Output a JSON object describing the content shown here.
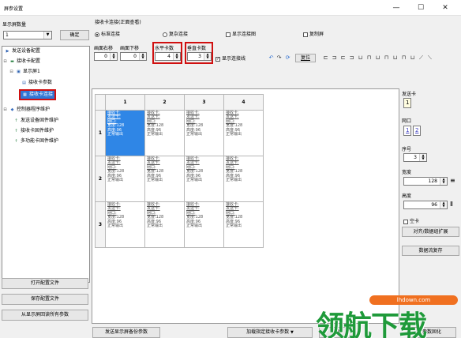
{
  "window": {
    "title": "屏参设置",
    "min": "—",
    "max": "☐",
    "close": "✕"
  },
  "left": {
    "screen_count_label": "显示屏数量",
    "screen_count_value": "1",
    "confirm_button": "确定",
    "tree": [
      {
        "label": "发送设备配置",
        "icon": "arrow-icon"
      },
      {
        "label": "接收卡配置",
        "icon": "card-icon"
      },
      {
        "label": "显示屏1",
        "icon": "screen-icon"
      },
      {
        "label": "接收卡参数",
        "icon": "param-icon"
      },
      {
        "label": "接收卡连接",
        "icon": "grid-icon"
      },
      {
        "label": "控制器程序维护",
        "icon": "controller-icon"
      },
      {
        "label": "发送设备固件维护",
        "icon": "upload-icon"
      },
      {
        "label": "接收卡固件维护",
        "icon": "upload-icon"
      },
      {
        "label": "多功能卡固件维护",
        "icon": "upload-icon"
      }
    ],
    "buttons": {
      "open_config": "打开配置文件",
      "save_config": "保存配置文件",
      "read_all": "从显示屏回读所有参数"
    }
  },
  "group": {
    "title": "接收卡连接(正面查看)",
    "radio_standard": "标准连接",
    "radio_complex": "复杂连接",
    "check_show_diagram": "显示连接图",
    "check_copy_screen": "复制屏",
    "fields": [
      {
        "label": "画面右移",
        "value": "0"
      },
      {
        "label": "画面下移",
        "value": "0"
      },
      {
        "label": "水平卡数",
        "value": "4"
      },
      {
        "label": "垂直卡数",
        "value": "3"
      }
    ],
    "check_show_lines": "显示连接线",
    "reset_button": "复位"
  },
  "grid": {
    "col_headers": [
      "1",
      "2",
      "3",
      "4"
    ],
    "row_headers": [
      "1",
      "2",
      "3"
    ],
    "cell_lines": [
      "接收卡:",
      "发送卡:",
      "网口:",
      "宽度:128",
      "高度:96",
      "正常输出"
    ]
  },
  "props": {
    "send_card_label": "发送卡",
    "send_card_value": "1",
    "port_label": "网口",
    "port_values": [
      "1",
      "2"
    ],
    "index_label": "序号",
    "index_value": "3",
    "width_label": "宽度",
    "width_value": "128",
    "height_label": "高度",
    "height_value": "96",
    "empty_card_label": "空卡",
    "align_button": "对齐/数据组扩展",
    "data_stream_button": "数据流复存"
  },
  "bottom": {
    "send_params": "发送显示屏备份参数",
    "load_recv": "加载指定接收卡参数",
    "save_receive": "参",
    "ok_button": "参数固化"
  },
  "watermark": {
    "text": "领航下载",
    "url": "lhdown.com"
  }
}
